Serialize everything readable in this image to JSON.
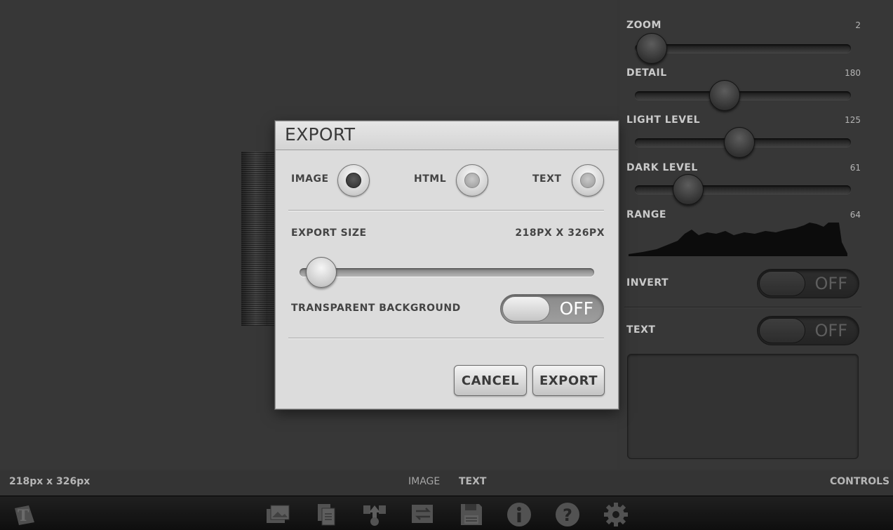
{
  "status_bar": {
    "dimensions": "218px x 326px",
    "view_image": "IMAGE",
    "view_text": "TEXT",
    "controls": "CONTROLS"
  },
  "controls": {
    "zoom": {
      "label": "ZOOM",
      "value": "2"
    },
    "detail": {
      "label": "DETAIL",
      "value": "180"
    },
    "light_level": {
      "label": "LIGHT LEVEL",
      "value": "125"
    },
    "dark_level": {
      "label": "DARK LEVEL",
      "value": "61"
    },
    "range": {
      "label": "RANGE",
      "value": "64"
    },
    "invert": {
      "label": "INVERT",
      "state": "OFF"
    },
    "text": {
      "label": "TEXT",
      "state": "OFF"
    }
  },
  "dialog": {
    "title": "EXPORT",
    "options": {
      "image": "IMAGE",
      "html": "HTML",
      "text": "TEXT",
      "selected": "IMAGE"
    },
    "export_size_label": "EXPORT SIZE",
    "export_size_value": "218PX X 326PX",
    "transparent_background_label": "TRANSPARENT BACKGROUND",
    "transparent_background_state": "OFF",
    "cancel_label": "CANCEL",
    "export_label": "EXPORT"
  },
  "toolbar": {
    "icons": [
      "app-logo-icon",
      "gallery-icon",
      "documents-icon",
      "share-icon",
      "swap-icon",
      "save-icon",
      "info-icon",
      "help-icon",
      "settings-icon"
    ]
  }
}
